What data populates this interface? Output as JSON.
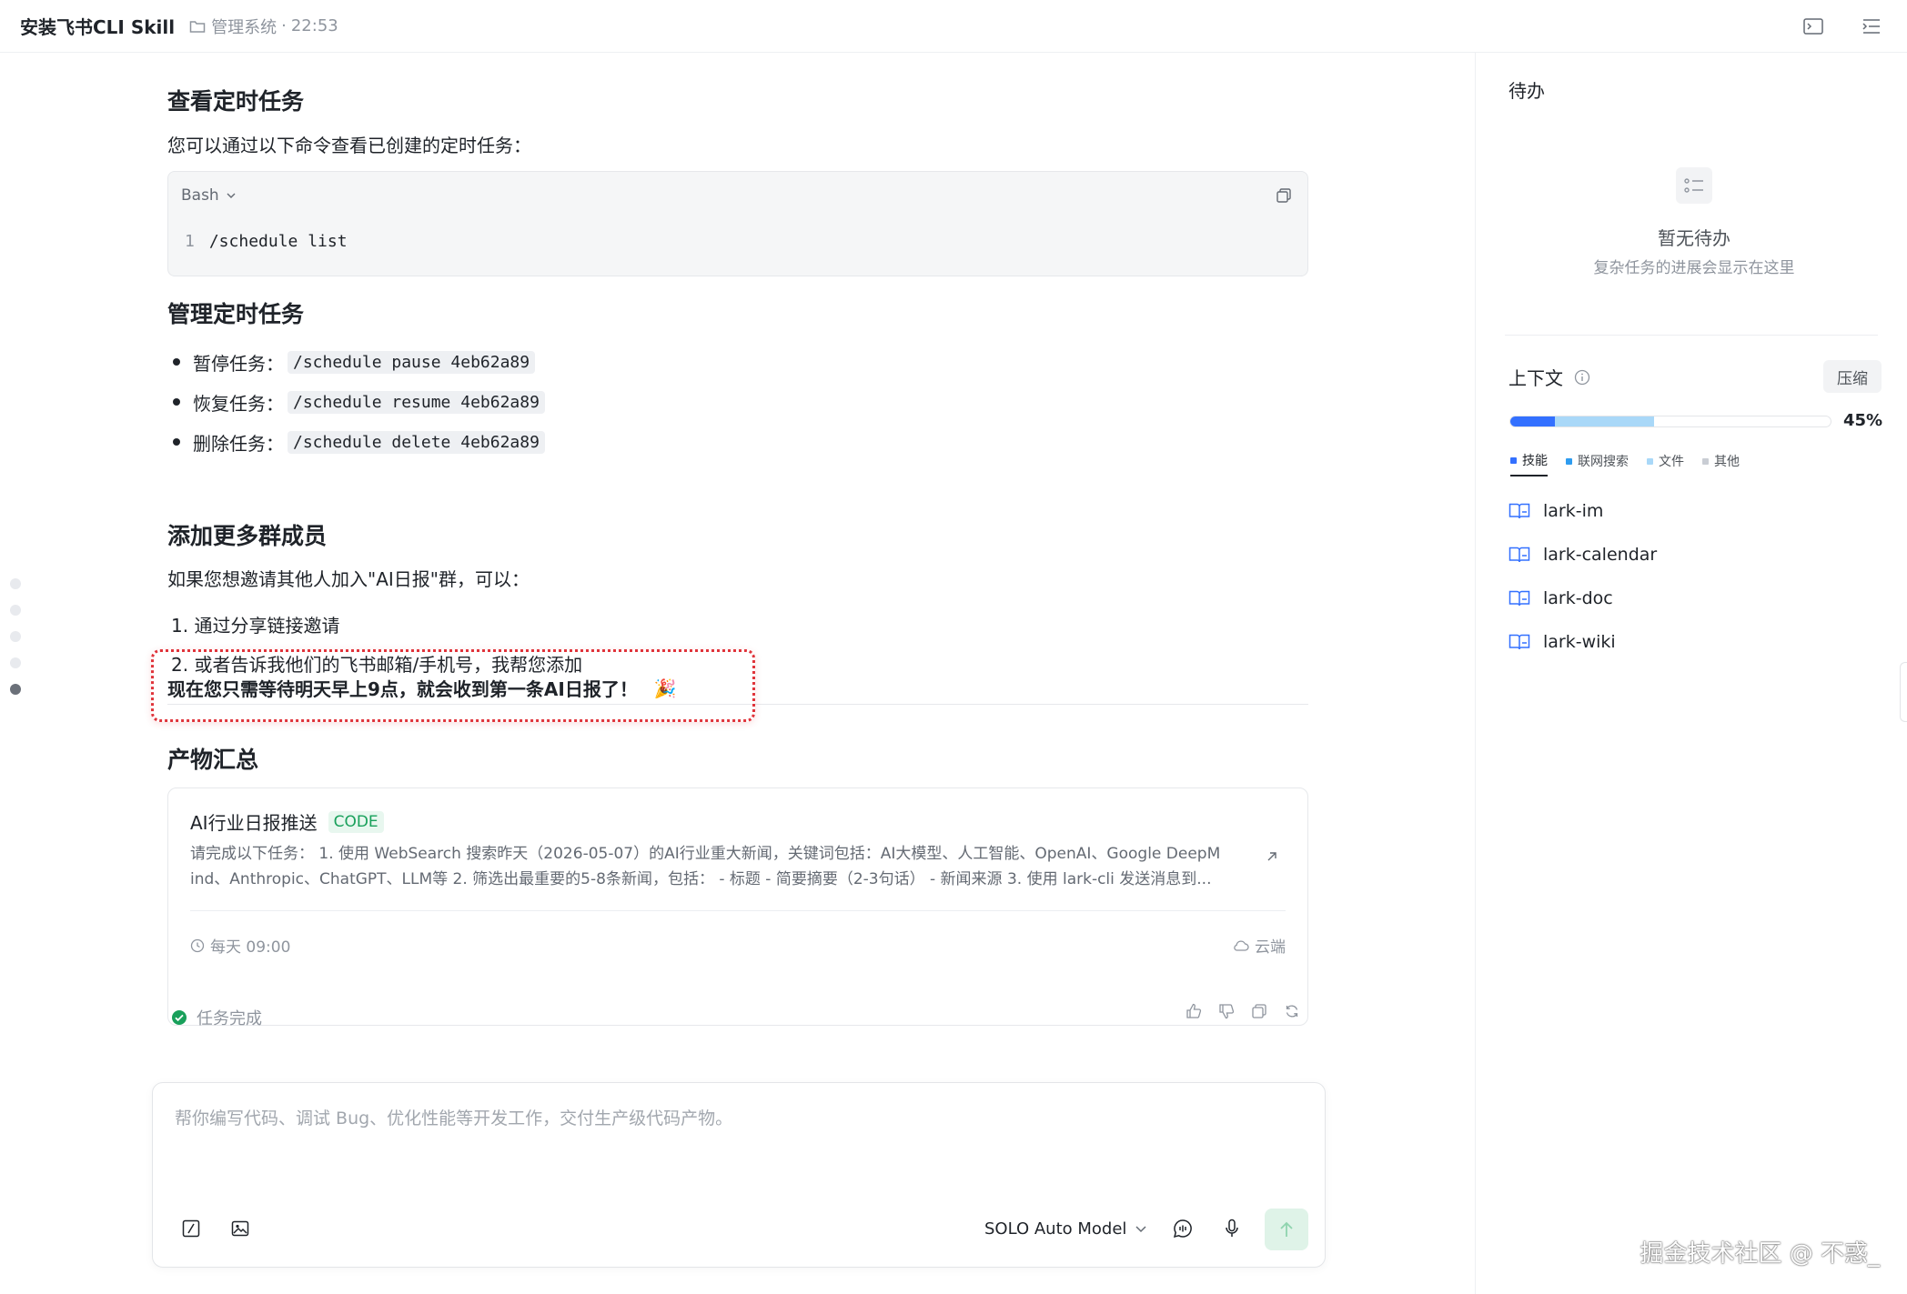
{
  "header": {
    "title": "安装飞书CLI Skill",
    "folder": "管理系统",
    "sep": "·",
    "time": "22:53"
  },
  "content": {
    "h_view": "查看定时任务",
    "p_view": "您可以通过以下命令查看已创建的定时任务：",
    "code": {
      "lang": "Bash",
      "line_no": "1",
      "line": "/schedule list"
    },
    "h_manage": "管理定时任务",
    "bullets": [
      {
        "label": "暂停任务：",
        "code": "/schedule pause 4eb62a89"
      },
      {
        "label": "恢复任务：",
        "code": "/schedule resume 4eb62a89"
      },
      {
        "label": "删除任务：",
        "code": "/schedule delete 4eb62a89"
      }
    ],
    "h_members": "添加更多群成员",
    "p_members": "如果您想邀请其他人加入\"AI日报\"群，可以：",
    "ol": [
      "1. 通过分享链接邀请",
      "2. 或者告诉我他们的飞书邮箱/手机号，我帮您添加"
    ],
    "highlight": "现在您只需等待明天早上9点，就会收到第一条AI日报了！",
    "highlight_emoji": "🎉",
    "h_artifacts": "产物汇总",
    "card": {
      "title": "AI行业日报推送",
      "badge": "CODE",
      "desc1": "请完成以下任务： 1. 使用 WebSearch 搜索昨天（2026-05-07）的AI行业重大新闻，关键词包括：AI大模型、人工智能、OpenAI、Google DeepM",
      "desc2": "ind、Anthropic、ChatGPT、LLM等 2. 筛选出最重要的5-8条新闻，包括： - 标题 - 简要摘要（2-3句话） - 新闻来源 3. 使用 lark-cli 发送消息到...",
      "schedule": "每天 09:00",
      "location": "云端"
    },
    "status": "任务完成"
  },
  "input": {
    "placeholder": "帮你编写代码、调试 Bug、优化性能等开发工作，交付生产级代码产物。",
    "model": "SOLO Auto Model"
  },
  "side": {
    "todo_title": "待办",
    "empty_title": "暂无待办",
    "empty_sub": "复杂任务的进展会显示在这里",
    "context_title": "上下文",
    "compress": "压缩",
    "usage_pct": "45%",
    "usage": {
      "skill": 0.14,
      "web": 0.31,
      "file": 0.0
    },
    "legend": [
      "技能",
      "联网搜索",
      "文件",
      "其他"
    ],
    "colors": {
      "skill": "#3370ff",
      "web": "#a9d8f8",
      "file": "#cfd3da",
      "other": "#c9cdd4"
    },
    "skills": [
      "lark-im",
      "lark-calendar",
      "lark-doc",
      "lark-wiki"
    ]
  },
  "watermark": "掘金技术社区 @ 不惑_"
}
